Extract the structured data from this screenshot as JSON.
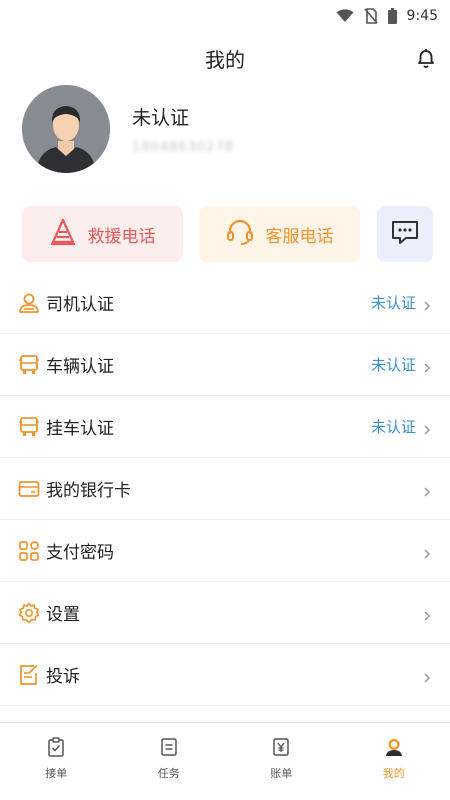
{
  "status_bar": {
    "time": "9:45",
    "icons": [
      "wifi-icon",
      "no-sim-icon",
      "battery-icon"
    ]
  },
  "header": {
    "title": "我的",
    "bell_icon": "bell-icon"
  },
  "profile": {
    "name": "未认证",
    "phone": "18048630278"
  },
  "quick_actions": {
    "rescue_label": "救援电话",
    "service_label": "客服电话"
  },
  "menu": {
    "items": [
      {
        "label": "司机认证",
        "status": "未认证",
        "icon": "driver-icon"
      },
      {
        "label": "车辆认证",
        "status": "未认证",
        "icon": "truck-icon"
      },
      {
        "label": "挂车认证",
        "status": "未认证",
        "icon": "trailer-icon"
      },
      {
        "label": "我的银行卡",
        "status": "",
        "icon": "bank-card-icon"
      },
      {
        "label": "支付密码",
        "status": "",
        "icon": "grid-icon"
      },
      {
        "label": "设置",
        "status": "",
        "icon": "gear-icon"
      },
      {
        "label": "投诉",
        "status": "",
        "icon": "edit-icon"
      }
    ]
  },
  "bottom_nav": {
    "items": [
      {
        "label": "接单",
        "icon": "clipboard-check-icon"
      },
      {
        "label": "任务",
        "icon": "list-icon"
      },
      {
        "label": "账单",
        "icon": "yen-icon"
      },
      {
        "label": "我的",
        "icon": "user-icon"
      }
    ],
    "active_index": 3
  },
  "colors": {
    "accent_orange": "#f0942b",
    "rescue_red": "#e8585a",
    "status_blue": "#3a8fd4",
    "message_blue": "#5b6fd0"
  }
}
